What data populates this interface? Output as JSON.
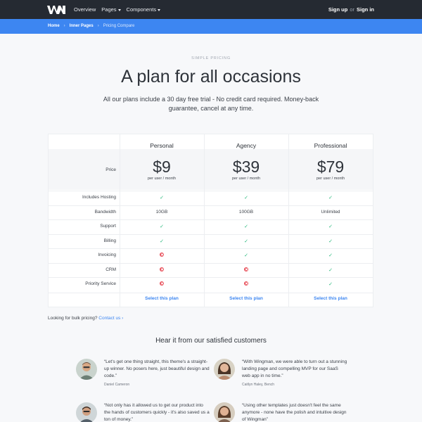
{
  "nav": {
    "logo": "WM",
    "links": [
      "Overview",
      "Pages",
      "Components"
    ],
    "sign_up": "Sign up",
    "or": "or",
    "sign_in": "Sign in"
  },
  "breadcrumb": {
    "items": [
      "Home",
      "Inner Pages",
      "Pricing Compare"
    ]
  },
  "header": {
    "eyebrow": "SIMPLE PRICING",
    "title": "A plan for all occasions",
    "lead": "All our plans include a 30 day free trial - No credit card required. Money-back guarantee, cancel at any time."
  },
  "pricing": {
    "plans": [
      {
        "name": "Personal",
        "price": "$9",
        "per": "per user / month",
        "select": "Select this plan"
      },
      {
        "name": "Agency",
        "price": "$39",
        "per": "per user / month",
        "select": "Select this plan"
      },
      {
        "name": "Professional",
        "price": "$79",
        "per": "per user / month",
        "select": "Select this plan"
      }
    ],
    "price_label": "Price",
    "check_glyph": "✓",
    "features": [
      {
        "label": "Includes Hosting",
        "values": [
          "check",
          "check",
          "check"
        ]
      },
      {
        "label": "Bandwidth",
        "values": [
          "10GB",
          "100GB",
          "Unlimited"
        ]
      },
      {
        "label": "Support",
        "values": [
          "check",
          "check",
          "check"
        ]
      },
      {
        "label": "Billing",
        "values": [
          "check",
          "check",
          "check"
        ]
      },
      {
        "label": "Invoicing",
        "values": [
          "cross",
          "check",
          "check"
        ]
      },
      {
        "label": "CRM",
        "values": [
          "cross",
          "cross",
          "check"
        ]
      },
      {
        "label": "Priority Service",
        "values": [
          "cross",
          "cross",
          "check"
        ]
      }
    ],
    "colors": {
      "check": "#26b87a",
      "cross": "#e8505b",
      "link": "#3d86f1"
    }
  },
  "bulk": {
    "text": "Looking for bulk pricing?",
    "link": "Contact us ›"
  },
  "testimonials": {
    "title": "Hear it from our satisfied customers",
    "items": [
      {
        "quote": "“Let's get one thing straight, this theme's a straight-up winner. No posers here, just beautiful design and code.”",
        "author": "Daniel Cameron"
      },
      {
        "quote": "“With Wingman, we were able to turn out a stunning landing page and compelling MVP for our SaaS web app in no time.”",
        "author": "Caitlyn Haley, Bench"
      },
      {
        "quote": "“Not only has it allowed us to get our product into the hands of customers quickly - it's also saved us a ton of money.”",
        "author": ""
      },
      {
        "quote": "“Using other templates just doesn't feel the same anymore - none have the polish and intuitive design of Wingman”",
        "author": ""
      }
    ]
  }
}
